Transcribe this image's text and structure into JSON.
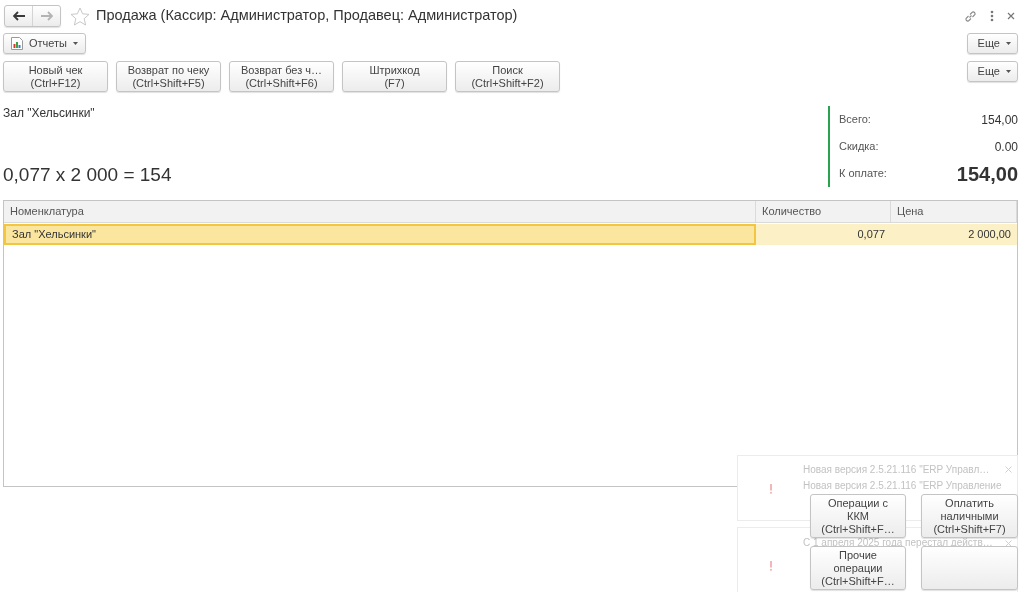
{
  "window": {
    "title": "Продажа (Кассир: Администратор, Продавец: Администратор)"
  },
  "nav": [
    {
      "kind": "back",
      "disabled": false
    },
    {
      "kind": "forward",
      "disabled": true
    }
  ],
  "toolbar": {
    "reports": "Отчеты",
    "more": "Еще"
  },
  "commands": [
    {
      "label": "Новый чек",
      "shortcut": "(Ctrl+F12)"
    },
    {
      "label": "Возврат по чеку",
      "shortcut": "(Ctrl+Shift+F5)"
    },
    {
      "label": "Возврат без ч…",
      "shortcut": "(Ctrl+Shift+F6)"
    },
    {
      "label": "Штрихкод",
      "shortcut": "(F7)"
    },
    {
      "label": "Поиск",
      "shortcut": "(Ctrl+Shift+F2)"
    }
  ],
  "commands_more": "Еще",
  "product_caption": "Зал \"Хельсинки\"",
  "calculation": "0,077 x 2 000 = 154",
  "totals": [
    {
      "kind": "normal",
      "label": "Всего:",
      "value": "154,00"
    },
    {
      "kind": "normal",
      "label": "Скидка:",
      "value": "0.00"
    },
    {
      "kind": "emphasis",
      "label": "К оплате:",
      "value": "154,00"
    }
  ],
  "table": {
    "columns": [
      "Номенклатура",
      "Количество",
      "Цена"
    ],
    "rows": [
      {
        "selected": true,
        "cells": [
          "Зал \"Хельсинки\"",
          "0,077",
          "2 000,00"
        ]
      }
    ]
  },
  "actions": [
    {
      "kind": "command",
      "label": "Операции с ККМ",
      "shortcut": "(Ctrl+Shift+F…"
    },
    {
      "kind": "command",
      "label": "Оплатить наличными",
      "shortcut": "(Ctrl+Shift+F7)"
    },
    {
      "kind": "command",
      "label": "Прочие операции",
      "shortcut": "(Ctrl+Shift+F…"
    },
    {
      "kind": "empty"
    }
  ],
  "notifications": [
    {
      "title": "Новая версия 2.5.21.116 \"ERP Управл…",
      "text": "Новая версия 2.5.21.116 \"ERP Управление"
    },
    {
      "title": "С 1 апреля 2025 года перестал действ…"
    }
  ]
}
